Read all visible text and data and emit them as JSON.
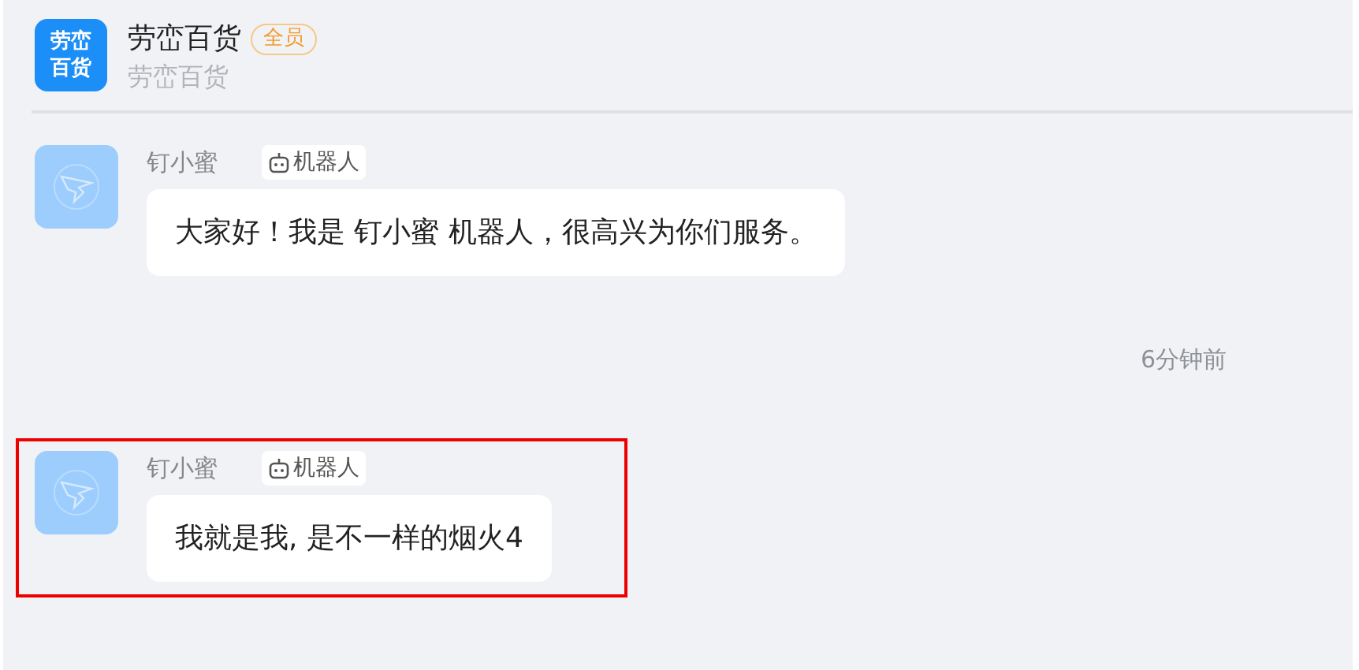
{
  "header": {
    "logo": "劳峦百货",
    "title": "劳峦百货",
    "badge": "全员",
    "subtitle": "劳峦百货"
  },
  "feed": [
    {
      "kind": "message",
      "sender": "钉小蜜",
      "tag": "机器人",
      "text": "大家好！我是 钉小蜜 机器人，很高兴为你们服务。",
      "highlighted": false
    },
    {
      "kind": "time",
      "text": "6分钟前"
    },
    {
      "kind": "message",
      "sender": "钉小蜜",
      "tag": "机器人",
      "text": "我就是我, 是不一样的烟火4",
      "highlighted": true
    }
  ]
}
